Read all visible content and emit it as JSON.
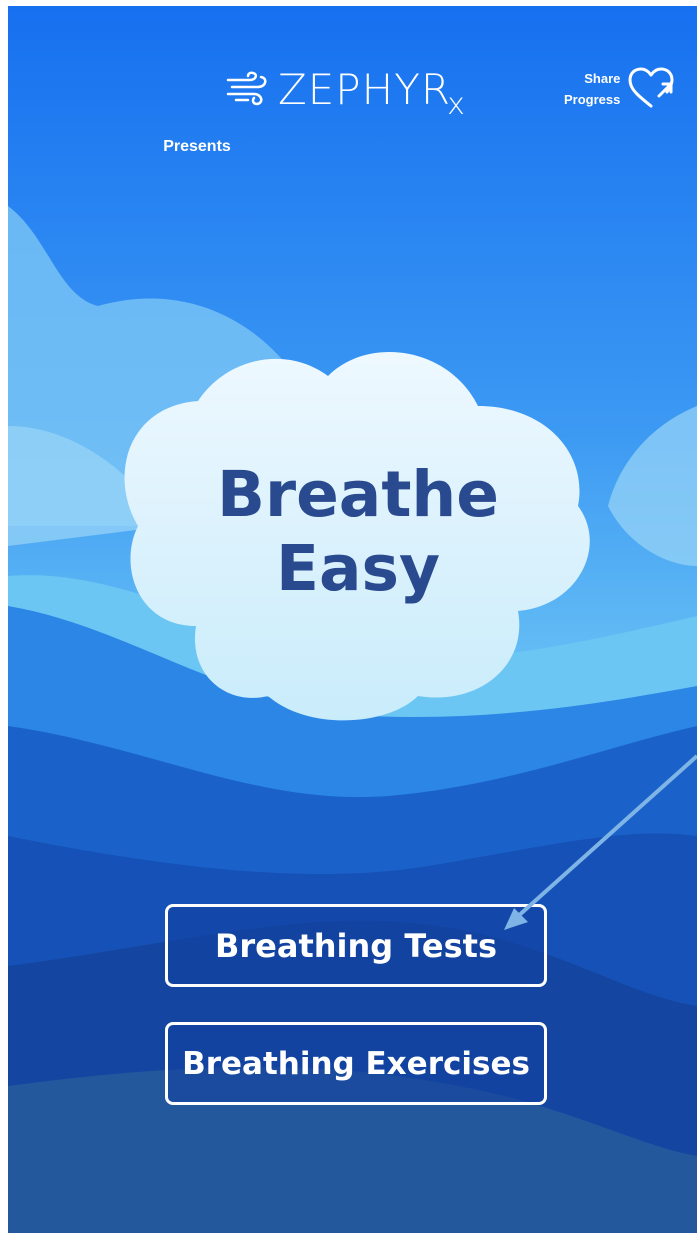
{
  "header": {
    "brand": "ZEPHYR",
    "brand_sub": "x",
    "presents": "Presents",
    "share_line1": "Share",
    "share_line2": "Progress"
  },
  "hero": {
    "title_line1": "Breathe",
    "title_line2": "Easy"
  },
  "buttons": {
    "tests": "Breathing Tests",
    "exercises": "Breathing Exercises"
  },
  "colors": {
    "sky_top": "#1b74f0",
    "title": "#2a4a8f",
    "button_border": "#ffffff"
  },
  "icons": {
    "logo": "wind-icon",
    "share": "heart-share-icon"
  }
}
